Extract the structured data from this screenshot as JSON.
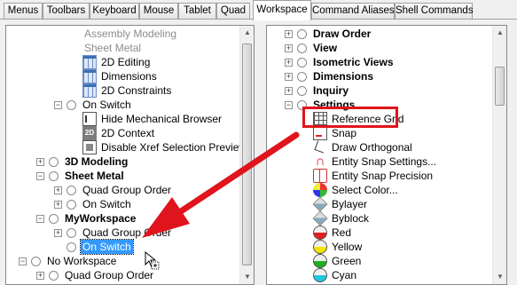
{
  "tabs": [
    {
      "label": "Menus"
    },
    {
      "label": "Toolbars"
    },
    {
      "label": "Keyboard"
    },
    {
      "label": "Mouse"
    },
    {
      "label": "Tablet"
    },
    {
      "label": "Quad"
    },
    {
      "label": "Workspace",
      "active": true
    },
    {
      "label": "Command Aliases"
    },
    {
      "label": "Shell Commands"
    }
  ],
  "left_tree": {
    "items": [
      {
        "label": "Assembly Modeling",
        "style": "gray"
      },
      {
        "label": "Sheet Metal",
        "style": "gray"
      },
      {
        "label": "2D Editing",
        "icon": "2d-editing-icon"
      },
      {
        "label": "Dimensions",
        "icon": "dimensions-icon"
      },
      {
        "label": "2D Constraints",
        "icon": "2d-constraints-icon"
      },
      {
        "label": "On Switch",
        "expander": "minus",
        "radio": true
      },
      {
        "label": "Hide Mechanical Browser",
        "icon": "browser-icon"
      },
      {
        "label": "2D Context",
        "icon": "2d-context-icon"
      },
      {
        "label": "Disable Xref Selection Preview",
        "icon": "xref-icon"
      },
      {
        "label": "3D Modeling",
        "expander": "plus",
        "radio": true,
        "style": "bold"
      },
      {
        "label": "Sheet Metal",
        "expander": "minus",
        "radio": true,
        "style": "bold"
      },
      {
        "label": "Quad Group Order",
        "expander": "plus",
        "radio": true
      },
      {
        "label": "On Switch",
        "expander": "plus",
        "radio": true
      },
      {
        "label": "MyWorkspace",
        "expander": "minus",
        "radio": true,
        "style": "bold"
      },
      {
        "label": "Quad Group Order",
        "expander": "plus",
        "radio": true
      },
      {
        "label": "On Switch",
        "radio": true,
        "style": "selected"
      },
      {
        "label": "No Workspace",
        "expander": "minus",
        "radio": true
      },
      {
        "label": "Quad Group Order",
        "expander": "plus",
        "radio": true
      }
    ]
  },
  "right_tree": {
    "items": [
      {
        "label": "Draw Order",
        "expander": "plus",
        "radio": true,
        "style": "bold"
      },
      {
        "label": "View",
        "expander": "plus",
        "radio": true,
        "style": "bold"
      },
      {
        "label": "Isometric Views",
        "expander": "plus",
        "radio": true,
        "style": "bold"
      },
      {
        "label": "Dimensions",
        "expander": "plus",
        "radio": true,
        "style": "bold"
      },
      {
        "label": "Inquiry",
        "expander": "plus",
        "radio": true,
        "style": "bold"
      },
      {
        "label": "Settings",
        "expander": "minus",
        "radio": true,
        "style": "bold"
      },
      {
        "label": "Reference Grid",
        "icon": "reference-grid-icon"
      },
      {
        "label": "Snap",
        "icon": "snap-icon"
      },
      {
        "label": "Draw Orthogonal",
        "icon": "draw-orthogonal-icon"
      },
      {
        "label": "Entity Snap Settings...",
        "icon": "magnet-icon"
      },
      {
        "label": "Entity Snap Precision",
        "icon": "snap-precision-icon"
      },
      {
        "label": "Select Color...",
        "icon": "color-wheel-icon"
      },
      {
        "label": "Bylayer",
        "icon": "bylayer-icon"
      },
      {
        "label": "Byblock",
        "icon": "byblock-icon"
      },
      {
        "label": "Red",
        "icon": "red-color-icon",
        "color": "#e02020"
      },
      {
        "label": "Yellow",
        "icon": "yellow-color-icon",
        "color": "#f2e600"
      },
      {
        "label": "Green",
        "icon": "green-color-icon",
        "color": "#20b020"
      },
      {
        "label": "Cyan",
        "icon": "cyan-color-icon",
        "color": "#20c8e0"
      }
    ]
  },
  "colors": {
    "selection": "#3399ff",
    "highlight_box": "#e0141c",
    "arrow": "#e0141c"
  }
}
